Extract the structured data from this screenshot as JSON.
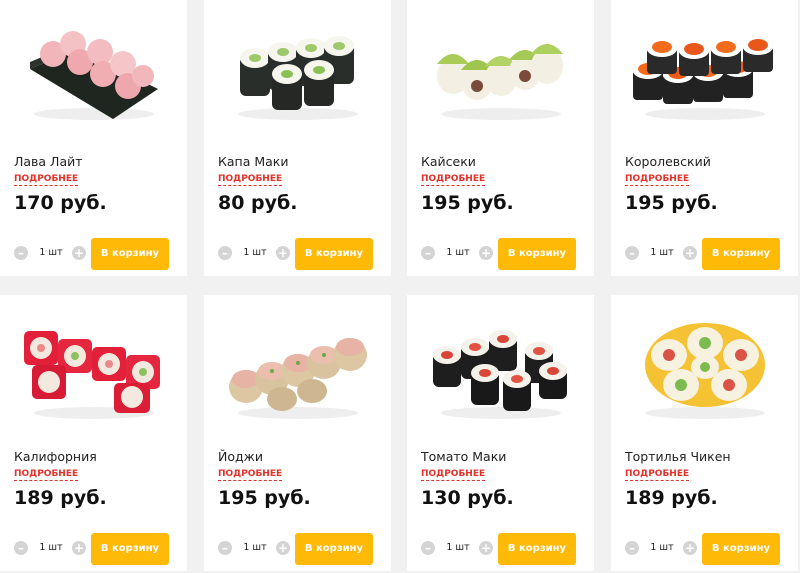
{
  "products": [
    {
      "name": "Лава Лайт",
      "more": "ПОДРОБНЕЕ",
      "price": "170 руб.",
      "qty": "1 шт",
      "cart": "В корзину",
      "image": "lava-lite-roll"
    },
    {
      "name": "Капа Маки",
      "more": "ПОДРОБНЕЕ",
      "price": "80 руб.",
      "qty": "1 шт",
      "cart": "В корзину",
      "image": "kappa-maki-roll"
    },
    {
      "name": "Кайсеки",
      "more": "ПОДРОБНЕЕ",
      "price": "195 руб.",
      "qty": "1 шт",
      "cart": "В корзину",
      "image": "kaiseki-roll"
    },
    {
      "name": "Королевский",
      "more": "ПОДРОБНЕЕ",
      "price": "195 руб.",
      "qty": "1 шт",
      "cart": "В корзину",
      "image": "royal-roll"
    },
    {
      "name": "Калифорния",
      "more": "ПОДРОБНЕЕ",
      "price": "189 руб.",
      "qty": "1 шт",
      "cart": "В корзину",
      "image": "california-roll"
    },
    {
      "name": "Йоджи",
      "more": "ПОДРОБНЕЕ",
      "price": "195 руб.",
      "qty": "1 шт",
      "cart": "В корзину",
      "image": "yoji-roll"
    },
    {
      "name": "Томато Маки",
      "more": "ПОДРОБНЕЕ",
      "price": "130 руб.",
      "qty": "1 шт",
      "cart": "В корзину",
      "image": "tomato-maki-roll"
    },
    {
      "name": "Тортилья Чикен",
      "more": "ПОДРОБНЕЕ",
      "price": "189 руб.",
      "qty": "1 шт",
      "cart": "В корзину",
      "image": "tortilla-chicken-roll"
    }
  ],
  "icons": {
    "minus": "minus-icon",
    "plus": "plus-icon"
  },
  "colors": {
    "accent": "#ffba08",
    "link": "#e2322a",
    "background": "#f1f1f1",
    "card": "#ffffff"
  }
}
